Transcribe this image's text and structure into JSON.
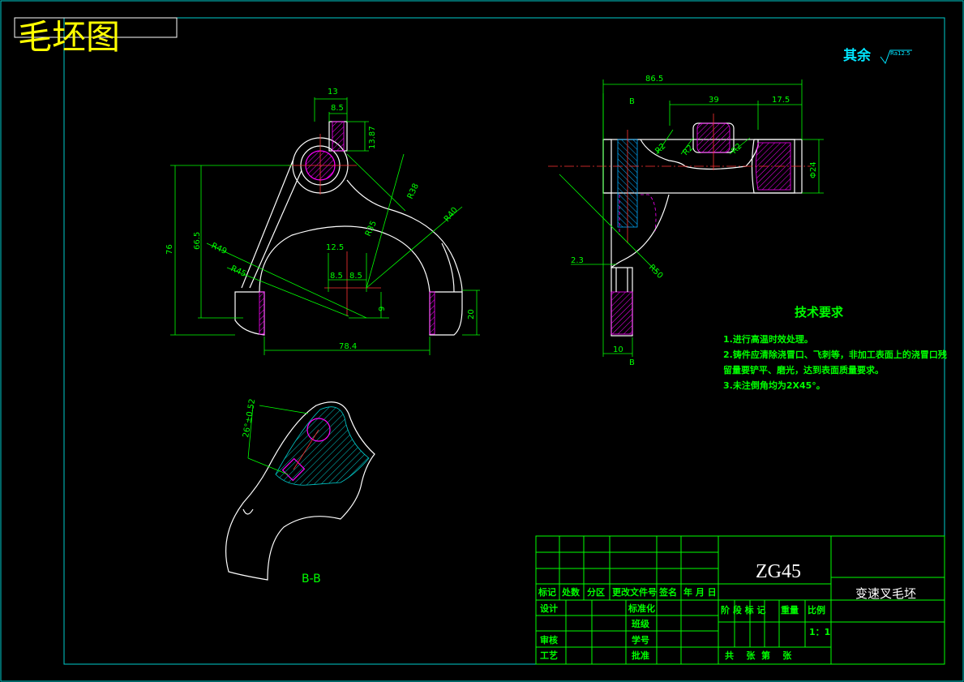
{
  "header": {
    "title": "毛坯图"
  },
  "surface_note": {
    "label": "其余",
    "roughness": "Ra12.5"
  },
  "dims_front": {
    "d13": "13",
    "d8_5": "8.5",
    "d13_87": "13.87",
    "d76": "76",
    "d66_5": "66.5",
    "d12_5": "12.5",
    "d8_5a": "8.5",
    "d8_5b": "8.5",
    "d9": "9",
    "d20": "20",
    "d78_4": "78.4",
    "r38": "R38",
    "r40": "R40",
    "r35": "R35",
    "r49": "R49",
    "r45": "R45"
  },
  "dims_side": {
    "d86_5": "86.5",
    "d39": "39",
    "d17_5": "17.5",
    "b": "B",
    "b2": "B",
    "r2a": "R2",
    "r2b": "R2",
    "r2c": "R2",
    "phi24": "Φ24",
    "d2_3": "2.3",
    "r50": "R50",
    "d10": "10"
  },
  "section": {
    "label": "B-B",
    "dim": "26°±0.52"
  },
  "tech": {
    "title": "技术要求",
    "items": [
      "1.进行高温时效处理。",
      "2.铸件应清除浇冒口、飞刺等，非加工表面上的浇冒口残",
      "留量要铲平、磨光，达到表面质量要求。",
      "3.未注倒角均为2X45°。"
    ]
  },
  "title_block": {
    "material": "ZG45",
    "part_name": "变速叉毛坯",
    "row_labels": [
      "标记",
      "处数",
      "分区",
      "更改文件号",
      "签名",
      "年 月 日"
    ],
    "design": "设计",
    "standard": "标准化",
    "class": "班级",
    "review": "审核",
    "student_no": "学号",
    "process": "工艺",
    "approve": "批准",
    "stage": "阶 段 标 记",
    "weight": "重量",
    "scale": "比例",
    "scale_value": "1：1",
    "sheet": "共    张  第    张"
  }
}
